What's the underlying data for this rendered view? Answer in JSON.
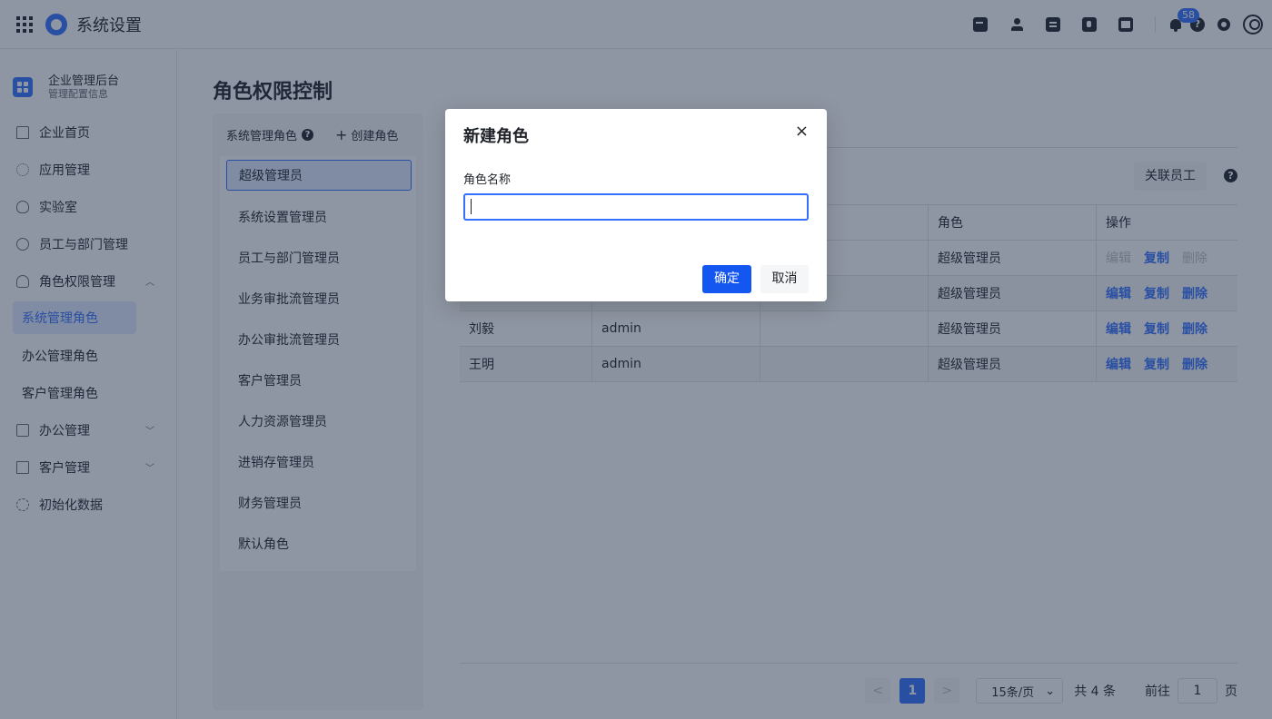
{
  "topbar": {
    "title": "系统设置",
    "notification_count": "58",
    "icons": [
      "grid-icon",
      "logo-icon",
      "calendar-check-icon",
      "user-icon",
      "document-icon",
      "phone-icon",
      "calendar-icon",
      "bell-icon",
      "help-icon",
      "gear-icon",
      "avatar-icon"
    ]
  },
  "sidebar": {
    "org_name": "企业管理后台",
    "org_sub": "管理配置信息",
    "items": [
      {
        "label": "企业首页",
        "icon": "home-icon"
      },
      {
        "label": "应用管理",
        "icon": "apps-icon"
      },
      {
        "label": "实验室",
        "icon": "lightbulb-icon"
      },
      {
        "label": "员工与部门管理",
        "icon": "people-icon"
      },
      {
        "label": "角色权限管理",
        "icon": "role-icon",
        "expanded": true
      }
    ],
    "role_subitems": [
      {
        "label": "系统管理角色",
        "active": true
      },
      {
        "label": "办公管理角色"
      },
      {
        "label": "客户管理角色"
      }
    ],
    "items_after": [
      {
        "label": "办公管理",
        "icon": "office-icon"
      },
      {
        "label": "客户管理",
        "icon": "client-icon"
      },
      {
        "label": "初始化数据",
        "icon": "init-icon"
      }
    ]
  },
  "main": {
    "page_title": "角色权限控制",
    "roles_panel": {
      "header": "系统管理角色",
      "create_label": "创建角色",
      "roles": [
        "超级管理员",
        "系统设置管理员",
        "员工与部门管理员",
        "业务审批流管理员",
        "办公审批流管理员",
        "客户管理员",
        "人力资源管理员",
        "进销存管理员",
        "财务管理员",
        "默认角色"
      ]
    },
    "link_employee_label": "关联员工",
    "table": {
      "headers": [
        "",
        "",
        "",
        "角色",
        "操作"
      ],
      "rows": [
        {
          "name": "",
          "account": "",
          "extra": "",
          "role": "超级管理员",
          "ops": [
            "编辑",
            "复制",
            "删除"
          ],
          "disabled": true
        },
        {
          "name": "",
          "account": "",
          "extra": "",
          "role": "超级管理员",
          "ops": [
            "编辑",
            "复制",
            "删除"
          ],
          "disabled": false
        },
        {
          "name": "刘毅",
          "account": "admin",
          "extra": "",
          "role": "超级管理员",
          "ops": [
            "编辑",
            "复制",
            "删除"
          ],
          "disabled": false
        },
        {
          "name": "王明",
          "account": "admin",
          "extra": "",
          "role": "超级管理员",
          "ops": [
            "编辑",
            "复制",
            "删除"
          ],
          "disabled": false
        }
      ]
    },
    "pager": {
      "prev": "<",
      "current": "1",
      "next": ">",
      "page_size": "15条/页",
      "total": "共 4 条",
      "goto_label": "前往",
      "goto_value": "1",
      "page_suffix": "页"
    }
  },
  "modal": {
    "title": "新建角色",
    "close": "×",
    "field_label": "角色名称",
    "field_value": "",
    "field_placeholder": "",
    "ok_label": "确定",
    "cancel_label": "取消"
  },
  "colors": {
    "accent": "#3370ff",
    "primary_button": "#1456f0",
    "overlay": "rgba(31,45,71,0.5)"
  }
}
